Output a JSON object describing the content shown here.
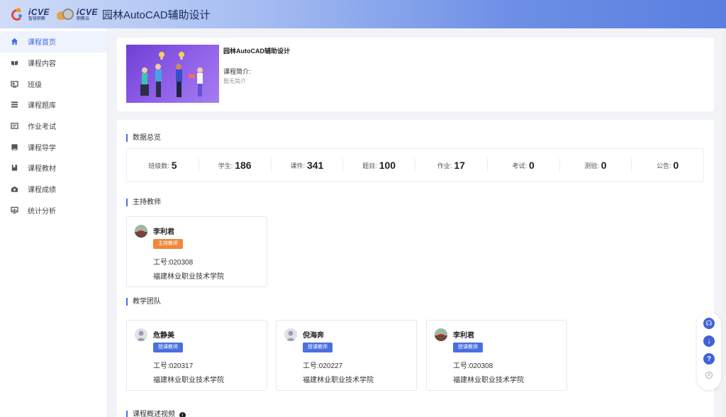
{
  "header": {
    "logo1_main": "iCVE",
    "logo1_sub": "智慧职教",
    "logo2_main": "iCVE",
    "logo2_sub": "职教云",
    "title": "园林AutoCAD辅助设计"
  },
  "sidebar": {
    "items": [
      {
        "label": "课程首页",
        "icon": "home-icon",
        "active": true
      },
      {
        "label": "课程内容",
        "icon": "book-open-icon"
      },
      {
        "label": "班级",
        "icon": "class-icon"
      },
      {
        "label": "课程题库",
        "icon": "list-icon"
      },
      {
        "label": "作业考试",
        "icon": "exam-icon"
      },
      {
        "label": "课程导学",
        "icon": "guide-icon"
      },
      {
        "label": "课程教材",
        "icon": "textbook-icon"
      },
      {
        "label": "课程成绩",
        "icon": "grade-icon"
      },
      {
        "label": "统计分析",
        "icon": "analytics-icon"
      }
    ]
  },
  "course": {
    "name": "园林AutoCAD辅助设计",
    "intro_label": "课程简介:",
    "intro_text": "暂无简介"
  },
  "overview": {
    "title": "数据总览",
    "stats": [
      {
        "label": "班级数:",
        "value": "5"
      },
      {
        "label": "学生:",
        "value": "186"
      },
      {
        "label": "课件:",
        "value": "341"
      },
      {
        "label": "题目:",
        "value": "100"
      },
      {
        "label": "作业:",
        "value": "17"
      },
      {
        "label": "考试:",
        "value": "0"
      },
      {
        "label": "测验:",
        "value": "0"
      },
      {
        "label": "公告:",
        "value": "0"
      }
    ]
  },
  "host_teacher": {
    "title": "主持教师",
    "name": "李利君",
    "role": "主持教师",
    "job": "工号:020308",
    "school": "福建林业职业技术学院"
  },
  "team": {
    "title": "教学团队",
    "members": [
      {
        "name": "危静美",
        "role": "授课教师",
        "job": "工号:020317",
        "school": "福建林业职业技术学院"
      },
      {
        "name": "倪海奔",
        "role": "授课教师",
        "job": "工号:020227",
        "school": "福建林业职业技术学院"
      },
      {
        "name": "李利君",
        "role": "授课教师",
        "job": "工号:020308",
        "school": "福建林业职业技术学院"
      }
    ]
  },
  "video_section": {
    "title": "课程概述视频"
  },
  "colors": {
    "accent": "#4a6fe0",
    "host_badge": "#f0873b"
  }
}
